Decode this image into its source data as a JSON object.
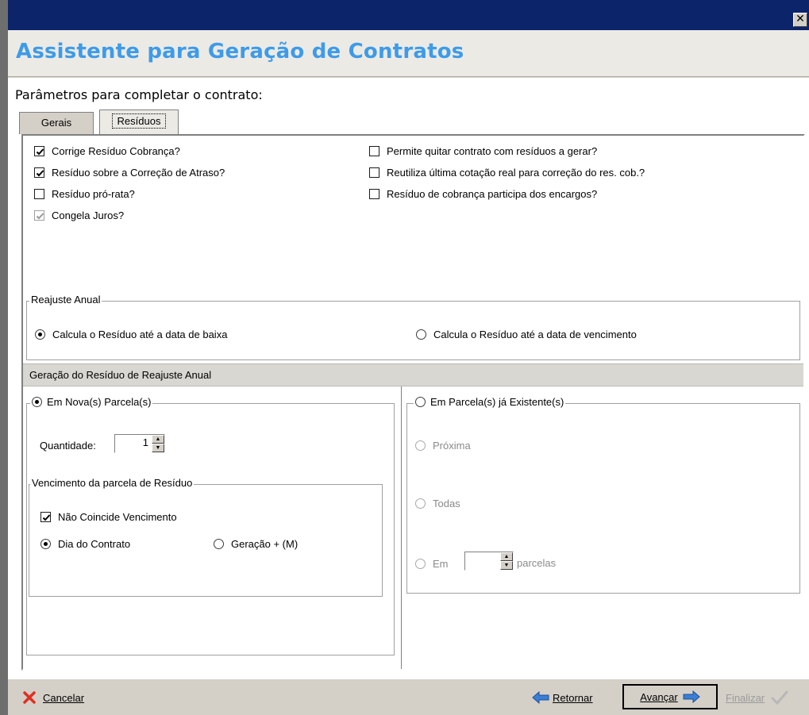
{
  "window": {
    "close_glyph": "✕",
    "title": "Assistente para Geração de Contratos"
  },
  "params_label": "Parâmetros para completar o contrato:",
  "tabs": [
    {
      "label": "Gerais"
    },
    {
      "label": "Resíduos",
      "selected": true
    }
  ],
  "checkboxes_left": [
    {
      "label": "Corrige Resíduo Cobrança?",
      "checked": true
    },
    {
      "label": "Resíduo sobre a Correção de Atraso?",
      "checked": true
    },
    {
      "label": "Resíduo pró-rata?",
      "checked": false
    },
    {
      "label": "Congela Juros?",
      "checked": true,
      "disabled": true
    }
  ],
  "checkboxes_right": [
    {
      "label": "Permite quitar contrato com resíduos a gerar?",
      "checked": false
    },
    {
      "label": "Reutiliza última cotação real para correção do res. cob.?",
      "checked": false
    },
    {
      "label": "Resíduo de cobrança participa dos encargos?",
      "checked": false
    }
  ],
  "reajuste": {
    "legend": "Reajuste Anual",
    "option_baixa": "Calcula o Resíduo até a data de baixa",
    "option_vencimento": "Calcula o Resíduo até a data de vencimento",
    "selected": "baixa"
  },
  "geracao": {
    "header": "Geração do Resíduo de Reajuste Anual",
    "nova": {
      "legend": "Em Nova(s) Parcela(s)",
      "selected": true,
      "quantidade_label": "Quantidade:",
      "quantidade_value": "1",
      "vencimento": {
        "legend": "Vencimento da parcela de Resíduo",
        "nao_coincide_label": "Não Coincide Vencimento",
        "nao_coincide_checked": true,
        "dia_contrato_label": "Dia do Contrato",
        "geracao_label": "Geração + (M)",
        "selected": "dia_contrato"
      }
    },
    "existente": {
      "legend": "Em Parcela(s) já Existente(s)",
      "selected": false,
      "proxima_label": "Próxima",
      "todas_label": "Todas",
      "em_label": "Em",
      "em_value": "",
      "parcelas_label": "parcelas"
    }
  },
  "footer": {
    "cancelar": "Cancelar",
    "retornar": "Retornar",
    "avancar": "Avançar",
    "finalizar": "Finalizar"
  },
  "colors": {
    "title_bar": "#0b246a",
    "title_text": "#3d9be9",
    "cancel_icon": "#e03020",
    "arrow_icon": "#3a7fd5"
  }
}
